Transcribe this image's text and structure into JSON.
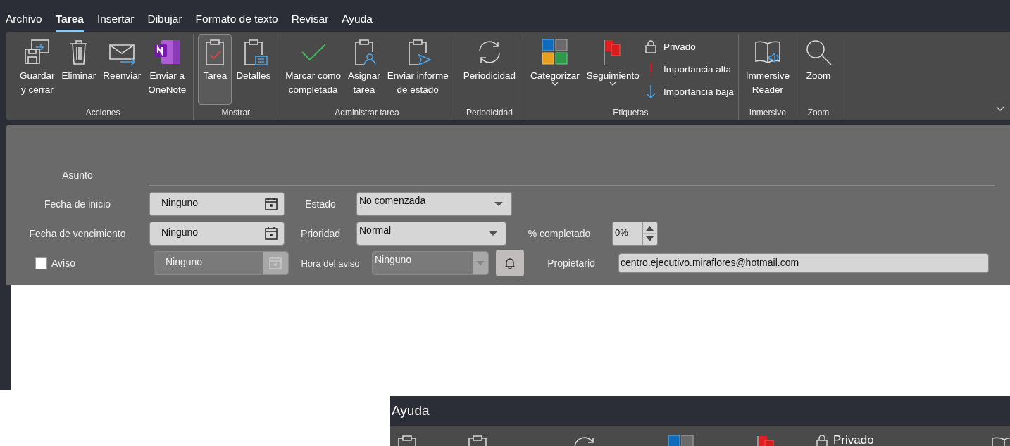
{
  "menu_tabs": [
    {
      "label": "Archivo",
      "selected": false
    },
    {
      "label": "Tarea",
      "selected": true
    },
    {
      "label": "Insertar",
      "selected": false
    },
    {
      "label": "Dibujar",
      "selected": false
    },
    {
      "label": "Formato de texto",
      "selected": false
    },
    {
      "label": "Revisar",
      "selected": false
    },
    {
      "label": "Ayuda",
      "selected": false
    }
  ],
  "ribbon": {
    "groups": [
      {
        "label": "Acciones",
        "buttons": [
          {
            "kind": "save",
            "label": "Guardar\ny cerrar",
            "selected": false
          },
          {
            "kind": "delete",
            "label": "Eliminar",
            "selected": false
          },
          {
            "kind": "forward",
            "label": "Reenviar",
            "selected": false
          },
          {
            "kind": "onenote",
            "label": "Enviar a\nOneNote",
            "selected": false
          }
        ]
      },
      {
        "label": "Mostrar",
        "buttons": [
          {
            "kind": "task",
            "label": "Tarea",
            "selected": true
          },
          {
            "kind": "details",
            "label": "Detalles",
            "selected": false
          }
        ]
      },
      {
        "label": "Administrar tarea",
        "buttons": [
          {
            "kind": "complete",
            "label": "Marcar como\ncompletada",
            "selected": false
          },
          {
            "kind": "assign",
            "label": "Asignar\ntarea",
            "selected": false
          },
          {
            "kind": "report",
            "label": "Enviar informe\nde estado",
            "selected": false
          }
        ]
      },
      {
        "label": "Periodicidad",
        "buttons": [
          {
            "kind": "recurrence",
            "label": "Periodicidad",
            "selected": false
          }
        ]
      },
      {
        "label": "Etiquetas",
        "buttons": [
          {
            "kind": "categorize",
            "label": "Categorizar",
            "dropdown": true,
            "selected": false
          },
          {
            "kind": "followup",
            "label": "Seguimiento",
            "dropdown": true,
            "selected": false
          }
        ],
        "small_buttons": [
          {
            "kind": "lock",
            "label": "Privado"
          },
          {
            "kind": "high",
            "label": "Importancia alta"
          },
          {
            "kind": "low",
            "label": "Importancia baja"
          }
        ]
      },
      {
        "label": "Inmersivo",
        "buttons": [
          {
            "kind": "reader",
            "label": "Immersive\nReader",
            "selected": false
          }
        ]
      },
      {
        "label": "Zoom",
        "buttons": [
          {
            "kind": "zoom",
            "label": "Zoom",
            "selected": false
          }
        ]
      }
    ]
  },
  "form": {
    "subject_label": "Asunto",
    "start_date": {
      "label": "Fecha de inicio",
      "value": "Ninguno"
    },
    "due_date": {
      "label": "Fecha de vencimiento",
      "value": "Ninguno"
    },
    "reminder": {
      "label": "Aviso",
      "checked": false,
      "date": "Ninguno",
      "time_label": "Hora del aviso",
      "time": "Ninguno",
      "disabled": true
    },
    "status": {
      "label": "Estado",
      "value": "No comenzada"
    },
    "priority": {
      "label": "Prioridad",
      "value": "Normal"
    },
    "percent": {
      "label": "% completado",
      "value": "0%"
    },
    "owner": {
      "label": "Propietario",
      "value": "centro.ejecutivo.miraflores@hotmail.com"
    }
  },
  "overlay": {
    "tab": "Ayuda",
    "items": [
      {
        "kind": "task"
      },
      {
        "kind": "task"
      },
      {
        "kind": "recurrence"
      },
      {
        "kind": "categorize"
      },
      {
        "kind": "followup"
      },
      {
        "kind": "lock",
        "label": "Privado"
      },
      {
        "kind": "reader"
      }
    ]
  }
}
